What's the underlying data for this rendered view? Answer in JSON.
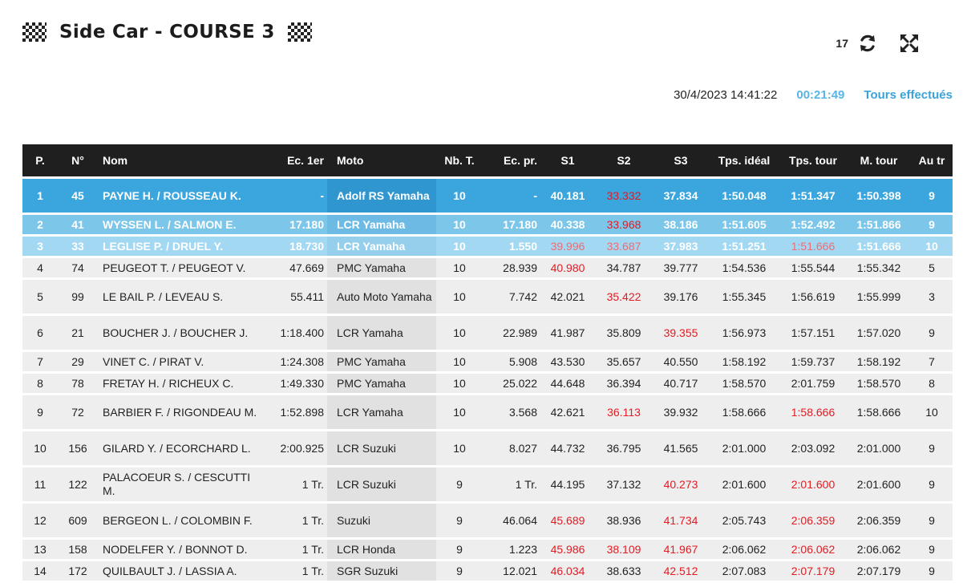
{
  "header": {
    "title": "Side Car - COURSE 3",
    "refresh_count": "17",
    "icons": [
      "checkered-flag-icon",
      "refresh-icon",
      "fullscreen-icon"
    ]
  },
  "meta": {
    "datetime": "30/4/2023 14:41:22",
    "elapsed": "00:21:49",
    "link": "Tours effectués"
  },
  "colors": {
    "header_bg": "#1f1f1f",
    "p1": "#3aa6dd",
    "p2": "#7cc6ea",
    "p3": "#a3d8f2",
    "best_sector": "#e31b23",
    "accent": "#58b6e4"
  },
  "table": {
    "columns": [
      "P.",
      "N°",
      "Nom",
      "Ec. 1er",
      "Moto",
      "Nb. T.",
      "Ec. pr.",
      "S1",
      "S2",
      "S3",
      "Tps. idéal",
      "Tps. tour",
      "M. tour",
      "Au tr"
    ],
    "rows": [
      {
        "p": "1",
        "n": "45",
        "nom": "PAYNE H. / ROUSSEAU K.",
        "ec1": "-",
        "moto": "Adolf RS Yamaha",
        "nbt": "10",
        "ecpr": "-",
        "s1": "40.181",
        "s2": "33.332",
        "s3": "37.834",
        "ideal": "1:50.048",
        "tour": "1:51.347",
        "mtour": "1:50.398",
        "autr": "9",
        "red": [
          "s2"
        ]
      },
      {
        "p": "2",
        "n": "41",
        "nom": "WYSSEN L. / SALMON E.",
        "ec1": "17.180",
        "moto": "LCR Yamaha",
        "nbt": "10",
        "ecpr": "17.180",
        "s1": "40.338",
        "s2": "33.968",
        "s3": "38.186",
        "ideal": "1:51.605",
        "tour": "1:52.492",
        "mtour": "1:51.866",
        "autr": "9",
        "red": [
          "s2"
        ]
      },
      {
        "p": "3",
        "n": "33",
        "nom": "LEGLISE P. / DRUEL Y.",
        "ec1": "18.730",
        "moto": "LCR Yamaha",
        "nbt": "10",
        "ecpr": "1.550",
        "s1": "39.996",
        "s2": "33.687",
        "s3": "37.983",
        "ideal": "1:51.251",
        "tour": "1:51.666",
        "mtour": "1:51.666",
        "autr": "10",
        "red": [
          "s1",
          "s2",
          "tour"
        ]
      },
      {
        "p": "4",
        "n": "74",
        "nom": "PEUGEOT T. / PEUGEOT V.",
        "ec1": "47.669",
        "moto": "PMC Yamaha",
        "nbt": "10",
        "ecpr": "28.939",
        "s1": "40.980",
        "s2": "34.787",
        "s3": "39.777",
        "ideal": "1:54.536",
        "tour": "1:55.544",
        "mtour": "1:55.342",
        "autr": "5",
        "red": [
          "s1"
        ]
      },
      {
        "p": "5",
        "n": "99",
        "nom": "LE BAIL P. / LEVEAU S.",
        "ec1": "55.411",
        "moto": "Auto Moto Yamaha",
        "nbt": "10",
        "ecpr": "7.742",
        "s1": "42.021",
        "s2": "35.422",
        "s3": "39.176",
        "ideal": "1:55.345",
        "tour": "1:56.619",
        "mtour": "1:55.999",
        "autr": "3",
        "red": [
          "s2"
        ]
      },
      {
        "p": "6",
        "n": "21",
        "nom": "BOUCHER J. / BOUCHER J.",
        "ec1": "1:18.400",
        "moto": "LCR Yamaha",
        "nbt": "10",
        "ecpr": "22.989",
        "s1": "41.987",
        "s2": "35.809",
        "s3": "39.355",
        "ideal": "1:56.973",
        "tour": "1:57.151",
        "mtour": "1:57.020",
        "autr": "9",
        "red": [
          "s3"
        ]
      },
      {
        "p": "7",
        "n": "29",
        "nom": "VINET C. / PIRAT V.",
        "ec1": "1:24.308",
        "moto": "PMC Yamaha",
        "nbt": "10",
        "ecpr": "5.908",
        "s1": "43.530",
        "s2": "35.657",
        "s3": "40.550",
        "ideal": "1:58.192",
        "tour": "1:59.737",
        "mtour": "1:58.192",
        "autr": "7",
        "red": []
      },
      {
        "p": "8",
        "n": "78",
        "nom": "FRETAY H. / RICHEUX C.",
        "ec1": "1:49.330",
        "moto": "PMC Yamaha",
        "nbt": "10",
        "ecpr": "25.022",
        "s1": "44.648",
        "s2": "36.394",
        "s3": "40.717",
        "ideal": "1:58.570",
        "tour": "2:01.759",
        "mtour": "1:58.570",
        "autr": "8",
        "red": []
      },
      {
        "p": "9",
        "n": "72",
        "nom": "BARBIER F. / RIGONDEAU M.",
        "ec1": "1:52.898",
        "moto": "LCR Yamaha",
        "nbt": "10",
        "ecpr": "3.568",
        "s1": "42.621",
        "s2": "36.113",
        "s3": "39.932",
        "ideal": "1:58.666",
        "tour": "1:58.666",
        "mtour": "1:58.666",
        "autr": "10",
        "red": [
          "s2",
          "tour"
        ]
      },
      {
        "p": "10",
        "n": "156",
        "nom": "GILARD Y. / ECORCHARD L.",
        "ec1": "2:00.925",
        "moto": "LCR Suzuki",
        "nbt": "10",
        "ecpr": "8.027",
        "s1": "44.732",
        "s2": "36.795",
        "s3": "41.565",
        "ideal": "2:01.000",
        "tour": "2:03.092",
        "mtour": "2:01.000",
        "autr": "9",
        "red": []
      },
      {
        "p": "11",
        "n": "122",
        "nom": "PALACOEUR S. / CESCUTTI M.",
        "ec1": "1 Tr.",
        "moto": "LCR Suzuki",
        "nbt": "9",
        "ecpr": "1 Tr.",
        "s1": "44.195",
        "s2": "37.132",
        "s3": "40.273",
        "ideal": "2:01.600",
        "tour": "2:01.600",
        "mtour": "2:01.600",
        "autr": "9",
        "red": [
          "s3",
          "tour"
        ]
      },
      {
        "p": "12",
        "n": "609",
        "nom": "BERGEON L. / COLOMBIN F.",
        "ec1": "1 Tr.",
        "moto": "Suzuki",
        "nbt": "9",
        "ecpr": "46.064",
        "s1": "45.689",
        "s2": "38.936",
        "s3": "41.734",
        "ideal": "2:05.743",
        "tour": "2:06.359",
        "mtour": "2:06.359",
        "autr": "9",
        "red": [
          "s1",
          "s3",
          "tour"
        ]
      },
      {
        "p": "13",
        "n": "158",
        "nom": "NODELFER Y. / BONNOT D.",
        "ec1": "1 Tr.",
        "moto": "LCR Honda",
        "nbt": "9",
        "ecpr": "1.223",
        "s1": "45.986",
        "s2": "38.109",
        "s3": "41.967",
        "ideal": "2:06.062",
        "tour": "2:06.062",
        "mtour": "2:06.062",
        "autr": "9",
        "red": [
          "s1",
          "s2",
          "s3",
          "tour"
        ]
      },
      {
        "p": "14",
        "n": "172",
        "nom": "QUILBAULT J. / LASSIA A.",
        "ec1": "1 Tr.",
        "moto": "SGR Suzuki",
        "nbt": "9",
        "ecpr": "12.021",
        "s1": "46.034",
        "s2": "38.633",
        "s3": "42.512",
        "ideal": "2:07.083",
        "tour": "2:07.179",
        "mtour": "2:07.179",
        "autr": "9",
        "red": [
          "s1",
          "s3",
          "tour"
        ]
      }
    ]
  }
}
